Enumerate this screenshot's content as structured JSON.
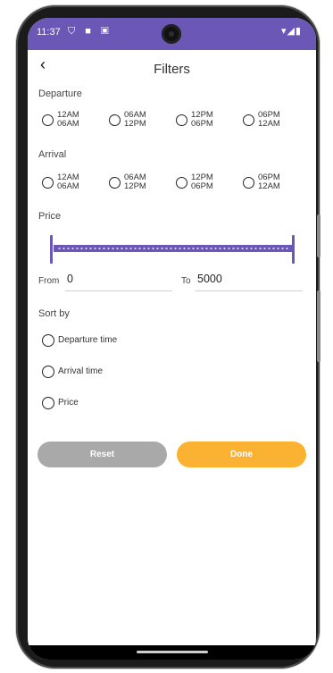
{
  "status_bar": {
    "time": "11:37",
    "left_icons": "⛉ ■ ▣",
    "right_icons": "▾◢▮",
    "color": "#6a57b6"
  },
  "app_bar": {
    "back_icon": "‹",
    "title": "Filters"
  },
  "departure": {
    "label": "Departure",
    "options": [
      {
        "line1": "12AM",
        "line2": "06AM"
      },
      {
        "line1": "06AM",
        "line2": "12PM"
      },
      {
        "line1": "12PM",
        "line2": "06PM"
      },
      {
        "line1": "06PM",
        "line2": "12AM"
      }
    ]
  },
  "arrival": {
    "label": "Arrival",
    "options": [
      {
        "line1": "12AM",
        "line2": "06AM"
      },
      {
        "line1": "06AM",
        "line2": "12PM"
      },
      {
        "line1": "12PM",
        "line2": "06PM"
      },
      {
        "line1": "06PM",
        "line2": "12AM"
      }
    ]
  },
  "price": {
    "label": "Price",
    "from_label": "From",
    "from_value": "0",
    "to_label": "To",
    "to_value": "5000"
  },
  "sort_by": {
    "label": "Sort by",
    "options": [
      "Departure time",
      "Arrival time",
      "Price"
    ]
  },
  "buttons": {
    "reset": "Reset",
    "done": "Done"
  },
  "colors": {
    "accent": "#6a57b6",
    "done": "#fbb232",
    "reset": "#a9a9a9"
  }
}
